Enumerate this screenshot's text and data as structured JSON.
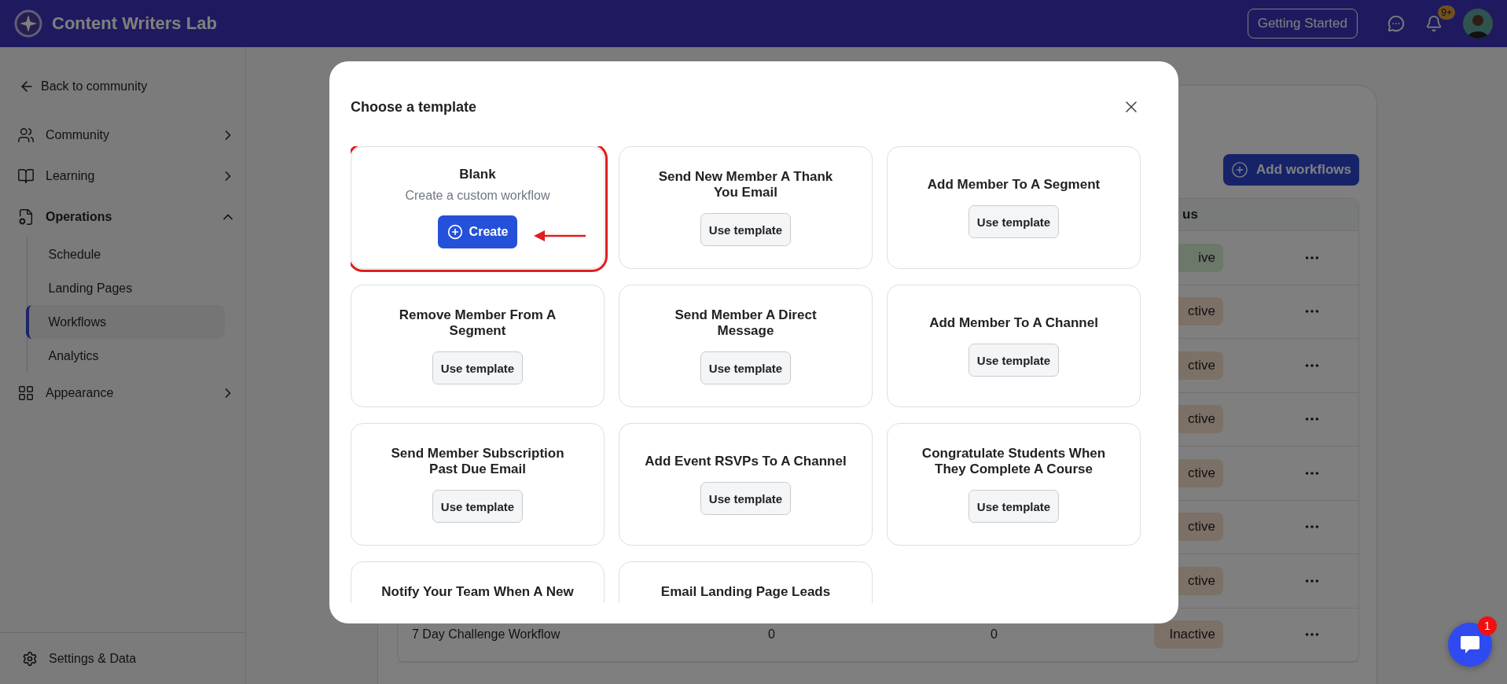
{
  "app": {
    "name": "Content Writers Lab"
  },
  "header": {
    "getting_started": "Getting Started",
    "notifications_badge": "9+"
  },
  "sidebar": {
    "back": "Back to community",
    "items": [
      {
        "kind": "community",
        "label": "Community",
        "expanded": false
      },
      {
        "kind": "learning",
        "label": "Learning",
        "expanded": false
      },
      {
        "kind": "operations",
        "label": "Operations",
        "expanded": true,
        "children": [
          {
            "label": "Schedule",
            "selected": false
          },
          {
            "label": "Landing Pages",
            "selected": false
          },
          {
            "label": "Workflows",
            "selected": true
          },
          {
            "label": "Analytics",
            "selected": false
          }
        ]
      },
      {
        "kind": "appearance",
        "label": "Appearance",
        "expanded": false
      }
    ],
    "footer": "Settings & Data"
  },
  "workflows": {
    "add_button": "Add workflows",
    "status_header": "us",
    "rows": [
      {
        "status": "ive",
        "active": true
      },
      {
        "status": "ctive",
        "active": false
      },
      {
        "status": "ctive",
        "active": false
      },
      {
        "status": "ctive",
        "active": false
      },
      {
        "status": "ctive",
        "active": false
      },
      {
        "status": "ctive",
        "active": false
      },
      {
        "status": "ctive",
        "active": false
      },
      {
        "name": "7 Day Challenge Workflow",
        "column_2": "0",
        "column_3": "0",
        "status": "Inactive",
        "active": false
      }
    ]
  },
  "modal": {
    "title": "Choose a template",
    "templates": [
      {
        "kind": "blank",
        "title_lines": [
          "Blank"
        ],
        "description": "Create a custom workflow",
        "button": "Create",
        "highlighted": true
      },
      {
        "kind": "template",
        "title_lines": [
          "Send New Member A Thank",
          "You Email"
        ],
        "button": "Use template",
        "highlighted": false
      },
      {
        "kind": "template",
        "title_lines": [
          "Add Member To A Segment"
        ],
        "button": "Use template",
        "highlighted": false
      },
      {
        "kind": "template",
        "title_lines": [
          "Remove Member From A",
          "Segment"
        ],
        "button": "Use template",
        "highlighted": false
      },
      {
        "kind": "template",
        "title_lines": [
          "Send Member A Direct",
          "Message"
        ],
        "button": "Use template",
        "highlighted": false
      },
      {
        "kind": "template",
        "title_lines": [
          "Add Member To A Channel"
        ],
        "button": "Use template",
        "highlighted": false
      },
      {
        "kind": "template",
        "title_lines": [
          "Send Member Subscription",
          "Past Due Email"
        ],
        "button": "Use template",
        "highlighted": false
      },
      {
        "kind": "template",
        "title_lines": [
          "Add Event RSVPs To A Channel"
        ],
        "button": "Use template",
        "highlighted": false
      },
      {
        "kind": "template",
        "title_lines": [
          "Congratulate Students When",
          "They Complete A Course"
        ],
        "button": "Use template",
        "highlighted": false
      },
      {
        "kind": "template",
        "title_lines": [
          "Notify Your Team When A New"
        ],
        "highlighted": false
      },
      {
        "kind": "template",
        "title_lines": [
          "Email Landing Page Leads"
        ],
        "highlighted": false
      }
    ]
  },
  "chat": {
    "badge": "1"
  }
}
